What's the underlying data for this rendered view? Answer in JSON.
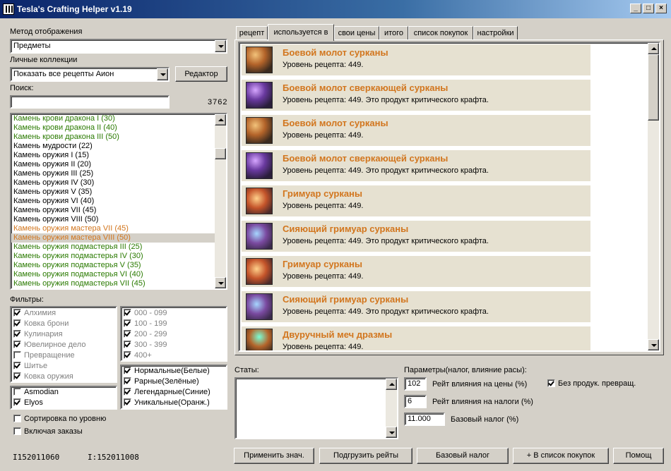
{
  "window": {
    "title": "Tesla's Crafting Helper v1.19"
  },
  "display_method": {
    "label": "Метод отображения",
    "value": "Предметы"
  },
  "collections": {
    "label": "Личные коллекции",
    "value": "Показать все рецепты Аион",
    "editor_button": "Редактор"
  },
  "search": {
    "label": "Поиск:",
    "value": "",
    "count": "3762"
  },
  "item_list": [
    {
      "text": "Камень крови дракона I (30)",
      "color": "#2a7a00"
    },
    {
      "text": "Камень крови дракона II (40)",
      "color": "#2a7a00"
    },
    {
      "text": "Камень крови дракона III (50)",
      "color": "#2a7a00"
    },
    {
      "text": "Камень мудрости (22)",
      "color": "#000000"
    },
    {
      "text": "Камень оружия I (15)",
      "color": "#000000"
    },
    {
      "text": "Камень оружия II (20)",
      "color": "#000000"
    },
    {
      "text": "Камень оружия III (25)",
      "color": "#000000"
    },
    {
      "text": "Камень оружия IV (30)",
      "color": "#000000"
    },
    {
      "text": "Камень оружия V (35)",
      "color": "#000000"
    },
    {
      "text": "Камень оружия VI (40)",
      "color": "#000000"
    },
    {
      "text": "Камень оружия VII (45)",
      "color": "#000000"
    },
    {
      "text": "Камень оружия VIII (50)",
      "color": "#000000"
    },
    {
      "text": "Камень оружия мастера VII (45)",
      "color": "#d2761e"
    },
    {
      "text": "Камень оружия мастера VIII (50)",
      "color": "#d2761e",
      "selected": true
    },
    {
      "text": "Камень оружия подмастерья III (25)",
      "color": "#2a7a00"
    },
    {
      "text": "Камень оружия подмастерья IV (30)",
      "color": "#2a7a00"
    },
    {
      "text": "Камень оружия подмастерья V (35)",
      "color": "#2a7a00"
    },
    {
      "text": "Камень оружия подмастерья VI (40)",
      "color": "#2a7a00"
    },
    {
      "text": "Камень оружия подмастерья VII (45)",
      "color": "#2a7a00"
    }
  ],
  "filters": {
    "label": "Фильтры:",
    "crafts": [
      {
        "text": "Алхимия",
        "checked": true
      },
      {
        "text": "Ковка брони",
        "checked": true
      },
      {
        "text": "Кулинария",
        "checked": true
      },
      {
        "text": "Ювелирное дело",
        "checked": true
      },
      {
        "text": "Превращение",
        "checked": false
      },
      {
        "text": "Шитье",
        "checked": true
      },
      {
        "text": "Ковка оружия",
        "checked": true
      }
    ],
    "levels": [
      {
        "text": "000 - 099",
        "checked": true
      },
      {
        "text": "100 - 199",
        "checked": true
      },
      {
        "text": "200 - 299",
        "checked": true
      },
      {
        "text": "300 - 399",
        "checked": true
      },
      {
        "text": "400+",
        "checked": true
      }
    ],
    "factions": [
      {
        "text": "Asmodian",
        "checked": false
      },
      {
        "text": "Elyos",
        "checked": true
      }
    ],
    "rarities": [
      {
        "text": "Нормальные(Белые)",
        "checked": true
      },
      {
        "text": "Рарные(Зелёные)",
        "checked": true
      },
      {
        "text": "Легендарные(Синие)",
        "checked": true
      },
      {
        "text": "Уникальные(Оранж.)",
        "checked": true
      }
    ]
  },
  "sort_by_level": {
    "text": "Сортировка по уровню",
    "checked": false
  },
  "include_orders": {
    "text": "Включая заказы",
    "checked": false
  },
  "status": {
    "left": "I152011060",
    "right": "I:152011008"
  },
  "tabs": [
    {
      "label": "рецепт",
      "active": false
    },
    {
      "label": "используется в",
      "active": true
    },
    {
      "label": "свои цены",
      "active": false
    },
    {
      "label": "итого",
      "active": false
    },
    {
      "label": "список покупок",
      "active": false
    },
    {
      "label": "настройки",
      "active": false
    }
  ],
  "recipes": [
    {
      "name": "Боевой молот сурканы",
      "desc": "Уровень рецепта: 449.",
      "icon": "hammer-icon"
    },
    {
      "name": "Боевой молот сверкающей сурканы",
      "desc": "Уровень рецепта: 449. Это продукт критического крафта.",
      "icon": "hammer-icon"
    },
    {
      "name": "Боевой молот сурканы",
      "desc": "Уровень рецепта: 449.",
      "icon": "hammer-icon"
    },
    {
      "name": "Боевой молот сверкающей сурканы",
      "desc": "Уровень рецепта: 449. Это продукт критического крафта.",
      "icon": "hammer-icon"
    },
    {
      "name": "Гримуар сурканы",
      "desc": "Уровень рецепта: 449.",
      "icon": "grimoire-icon"
    },
    {
      "name": "Сияющий гримуар сурканы",
      "desc": "Уровень рецепта: 449. Это продукт критического крафта.",
      "icon": "grimoire-icon"
    },
    {
      "name": "Гримуар сурканы",
      "desc": "Уровень рецепта: 449.",
      "icon": "grimoire-icon"
    },
    {
      "name": "Сияющий гримуар сурканы",
      "desc": "Уровень рецепта: 449. Это продукт критического крафта.",
      "icon": "grimoire-icon"
    },
    {
      "name": "Двуручный меч дразмы",
      "desc": "Уровень рецепта: 449.",
      "icon": "sword-icon"
    }
  ],
  "stats": {
    "label": "Статы:",
    "value": ""
  },
  "params": {
    "label": "Параметры(налог, влияние расы):",
    "price_rate": {
      "value": "102",
      "label": "Рейт влияния на цены (%)"
    },
    "tax_rate": {
      "value": "6",
      "label": "Рейт влияния на налоги (%)"
    },
    "base_tax": {
      "value": "11.000",
      "label": "Базовый налог (%)"
    },
    "no_transform": {
      "text": "Без продук. превращ.",
      "checked": true
    }
  },
  "bottom_buttons": {
    "apply": "Применить знач.",
    "load_rates": "Подгрузить рейты",
    "base_tax": "Базовый налог",
    "add_to_list": "+ В список покупок",
    "help": "Помощ"
  }
}
